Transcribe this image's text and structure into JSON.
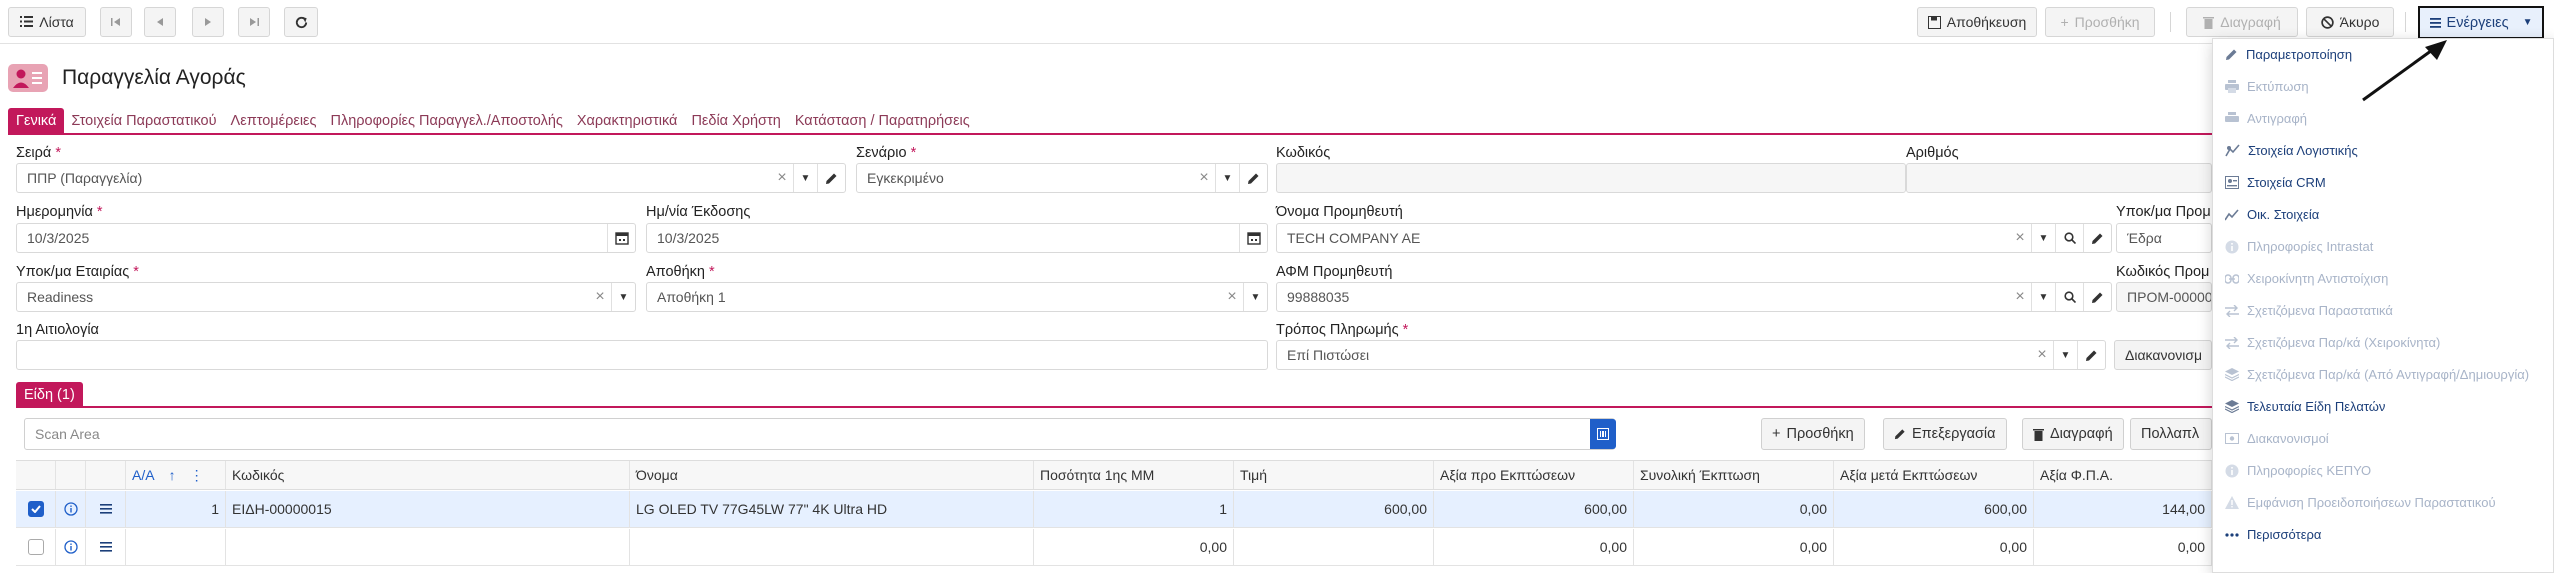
{
  "toolbar": {
    "list_label": "Λίστα",
    "save_label": "Αποθήκευση",
    "add_label": "Προσθήκη",
    "delete_label": "Διαγραφή",
    "cancel_label": "Άκυρο",
    "actions_label": "Ενέργειες"
  },
  "page": {
    "title": "Παραγγελία Αγοράς"
  },
  "tabs": [
    "Γενικά",
    "Στοιχεία Παραστατικού",
    "Λεπτομέρειες",
    "Πληροφορίες Παραγγελ./Αποστολής",
    "Χαρακτηριστικά",
    "Πεδία Χρήστη",
    "Κατάσταση / Παρατηρήσεις"
  ],
  "form": {
    "series_label": "Σειρά",
    "series_value": "ΠΠΡ (Παραγγελία)",
    "scenario_label": "Σενάριο",
    "scenario_value": "Εγκεκριμένο",
    "code_label": "Κωδικός",
    "code_value": "",
    "number_label": "Αριθμός",
    "number_value": "",
    "date_label": "Ημερομηνία",
    "date_value": "10/3/2025",
    "issue_date_label": "Ημ/νία Έκδοσης",
    "issue_date_value": "10/3/2025",
    "supplier_name_label": "Όνομα Προμηθευτή",
    "supplier_name_value": "TECH COMPANY AE",
    "supplier_branch_label": "Υποκ/μα Προμ",
    "supplier_branch_value": "Έδρα",
    "company_branch_label": "Υποκ/μα Εταιρίας",
    "company_branch_value": "Readiness",
    "warehouse_label": "Αποθήκη",
    "warehouse_value": "Αποθήκη 1",
    "supplier_vat_label": "ΑΦΜ Προμηθευτή",
    "supplier_vat_value": "99888035",
    "supplier_code_label": "Κωδικός Προμ",
    "supplier_code_value": "ΠΡΟΜ-00000",
    "reason_label": "1η Αιτιολογία",
    "reason_value": "",
    "payment_label": "Τρόπος Πληρωμής",
    "payment_value": "Επί Πιστώσει",
    "arrangements_label": "Διακανονισμ"
  },
  "items_tab": "Είδη (1)",
  "items_toolbar": {
    "scan_placeholder": "Scan Area",
    "add_label": "Προσθήκη",
    "edit_label": "Επεξεργασία",
    "delete_label": "Διαγραφή",
    "multi_label": "Πολλαπλ"
  },
  "grid": {
    "headers": [
      "Α/Α",
      "Κωδικός",
      "Όνομα",
      "Ποσότητα 1ης ΜΜ",
      "Τιμή",
      "Αξία προ Εκπτώσεων",
      "Συνολική Έκπτωση",
      "Αξία μετά Εκπτώσεων",
      "Αξία Φ.Π.Α."
    ],
    "rows": [
      {
        "aa": "1",
        "code": "ΕΙΔΗ-00000015",
        "name": "LG OLED TV 77G45LW 77\" 4K Ultra HD",
        "qty": "1",
        "price": "600,00",
        "value_before": "600,00",
        "discount": "0,00",
        "value_after": "600,00",
        "vat": "144,00"
      },
      {
        "aa": "",
        "code": "",
        "name": "",
        "qty": "0,00",
        "price": "",
        "value_before": "0,00",
        "discount": "0,00",
        "value_after": "0,00",
        "vat": "0,00"
      }
    ]
  },
  "actions_menu": [
    {
      "label": "Παραμετροποίηση",
      "icon": "pencil-icon",
      "enabled": true
    },
    {
      "label": "Εκτύπωση",
      "icon": "printer-icon",
      "enabled": false
    },
    {
      "label": "Αντιγραφή",
      "icon": "copy-icon",
      "enabled": false
    },
    {
      "label": "Στοιχεία Λογιστικής",
      "icon": "accounting-icon",
      "enabled": true
    },
    {
      "label": "Στοιχεία CRM",
      "icon": "crm-icon",
      "enabled": true
    },
    {
      "label": "Οικ. Στοιχεία",
      "icon": "chart-icon",
      "enabled": true
    },
    {
      "label": "Πληροφορίες Intrastat",
      "icon": "info-icon",
      "enabled": false
    },
    {
      "label": "Χειροκίνητη Αντιστοίχιση",
      "icon": "link-icon",
      "enabled": false
    },
    {
      "label": "Σχετιζόμενα Παραστατικά",
      "icon": "swap-icon",
      "enabled": false
    },
    {
      "label": "Σχετιζόμενα Παρ/κά (Χειροκίνητα)",
      "icon": "swap-icon",
      "enabled": false
    },
    {
      "label": "Σχετιζόμενα Παρ/κά (Από Αντιγραφή/Δημιουργία)",
      "icon": "layers-icon",
      "enabled": false
    },
    {
      "label": "Τελευταία Είδη Πελατών",
      "icon": "layers-icon",
      "enabled": true
    },
    {
      "label": "Διακανονισμοί",
      "icon": "money-icon",
      "enabled": false
    },
    {
      "label": "Πληροφορίες ΚΕΠΥΟ",
      "icon": "info-icon",
      "enabled": false
    },
    {
      "label": "Εμφάνιση Προειδοποιήσεων Παραστατικού",
      "icon": "warning-icon",
      "enabled": false
    },
    {
      "label": "Περισσότερα",
      "icon": "more-icon",
      "enabled": true
    }
  ],
  "colors": {
    "accent": "#c2185b",
    "link": "#1c3f7a",
    "primary": "#1f5fc9"
  }
}
